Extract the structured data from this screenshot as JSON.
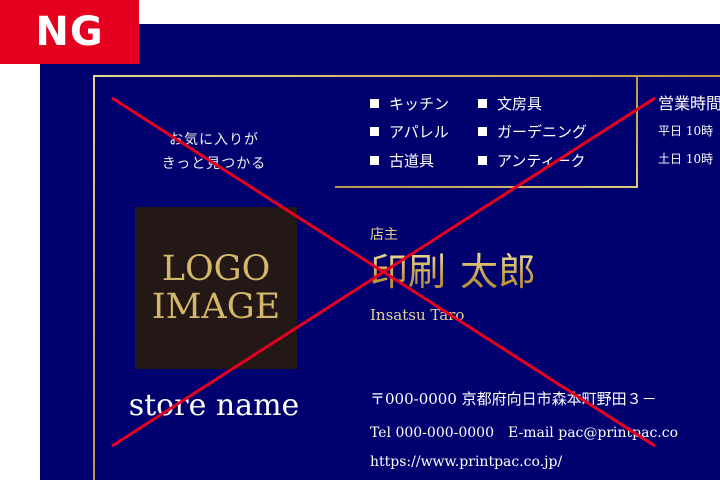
{
  "badge": {
    "label": "NG"
  },
  "card": {
    "tagline_line1": "お気に入りが",
    "tagline_line2": "きっと見つかる",
    "logo_line1": "LOGO",
    "logo_line2": "IMAGE",
    "store_name": "store name",
    "categories": [
      "キッチン",
      "文房具",
      "アパレル",
      "ガーデニング",
      "古道具",
      "アンティーク"
    ],
    "hours_title": "営業時間",
    "hours_weekday": "平日 10時",
    "hours_saturday": "土日 10時",
    "role": "店主",
    "name_family": "印刷",
    "name_given": "太郎",
    "name_romaji": "Insatsu Taro",
    "address": "〒000-0000 京都府向日市森本町野田３－",
    "contact": "Tel 000-000-0000　E-mail pac@printpac.co",
    "url": "https://www.printpac.co.jp/"
  },
  "colors": {
    "background": "#00006e",
    "gold": "#c9a44c",
    "cross": "#e6001f",
    "badge": "#e6001f"
  }
}
